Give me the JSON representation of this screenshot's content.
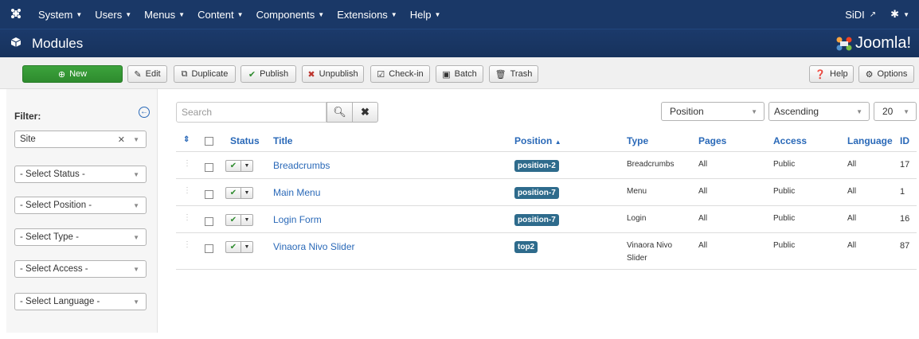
{
  "topbar": {
    "menu": [
      {
        "label": "System"
      },
      {
        "label": "Users"
      },
      {
        "label": "Menus"
      },
      {
        "label": "Content"
      },
      {
        "label": "Components"
      },
      {
        "label": "Extensions"
      },
      {
        "label": "Help"
      }
    ],
    "user": "SiDI"
  },
  "header": {
    "title": "Modules",
    "brand": "Joomla!"
  },
  "toolbar": {
    "new": "New",
    "edit": "Edit",
    "duplicate": "Duplicate",
    "publish": "Publish",
    "unpublish": "Unpublish",
    "checkin": "Check-in",
    "batch": "Batch",
    "trash": "Trash",
    "help": "Help",
    "options": "Options"
  },
  "sidebar": {
    "filter_label": "Filter:",
    "client": "Site",
    "status": "- Select Status -",
    "position": "- Select Position -",
    "type": "- Select Type -",
    "access": "- Select Access -",
    "language": "- Select Language -"
  },
  "search": {
    "placeholder": "Search"
  },
  "ordering": {
    "field": "Position",
    "direction": "Ascending",
    "limit": "20"
  },
  "table": {
    "headers": {
      "status": "Status",
      "title": "Title",
      "position": "Position",
      "type": "Type",
      "pages": "Pages",
      "access": "Access",
      "language": "Language",
      "id": "ID"
    },
    "rows": [
      {
        "title": "Breadcrumbs",
        "position": "position-2",
        "type": "Breadcrumbs",
        "type2": "",
        "pages": "All",
        "access": "Public",
        "language": "All",
        "id": "17"
      },
      {
        "title": "Main Menu",
        "position": "position-7",
        "type": "Menu",
        "type2": "",
        "pages": "All",
        "access": "Public",
        "language": "All",
        "id": "1"
      },
      {
        "title": "Login Form",
        "position": "position-7",
        "type": "Login",
        "type2": "",
        "pages": "All",
        "access": "Public",
        "language": "All",
        "id": "16"
      },
      {
        "title": "Vinaora Nivo Slider",
        "position": "top2",
        "type": "Vinaora Nivo",
        "type2": "Slider",
        "pages": "All",
        "access": "Public",
        "language": "All",
        "id": "87"
      }
    ]
  },
  "colors": {
    "navy": "#1a3867",
    "link": "#2a69b8",
    "green": "#2e8b2e",
    "badge": "#2e6b8c"
  }
}
